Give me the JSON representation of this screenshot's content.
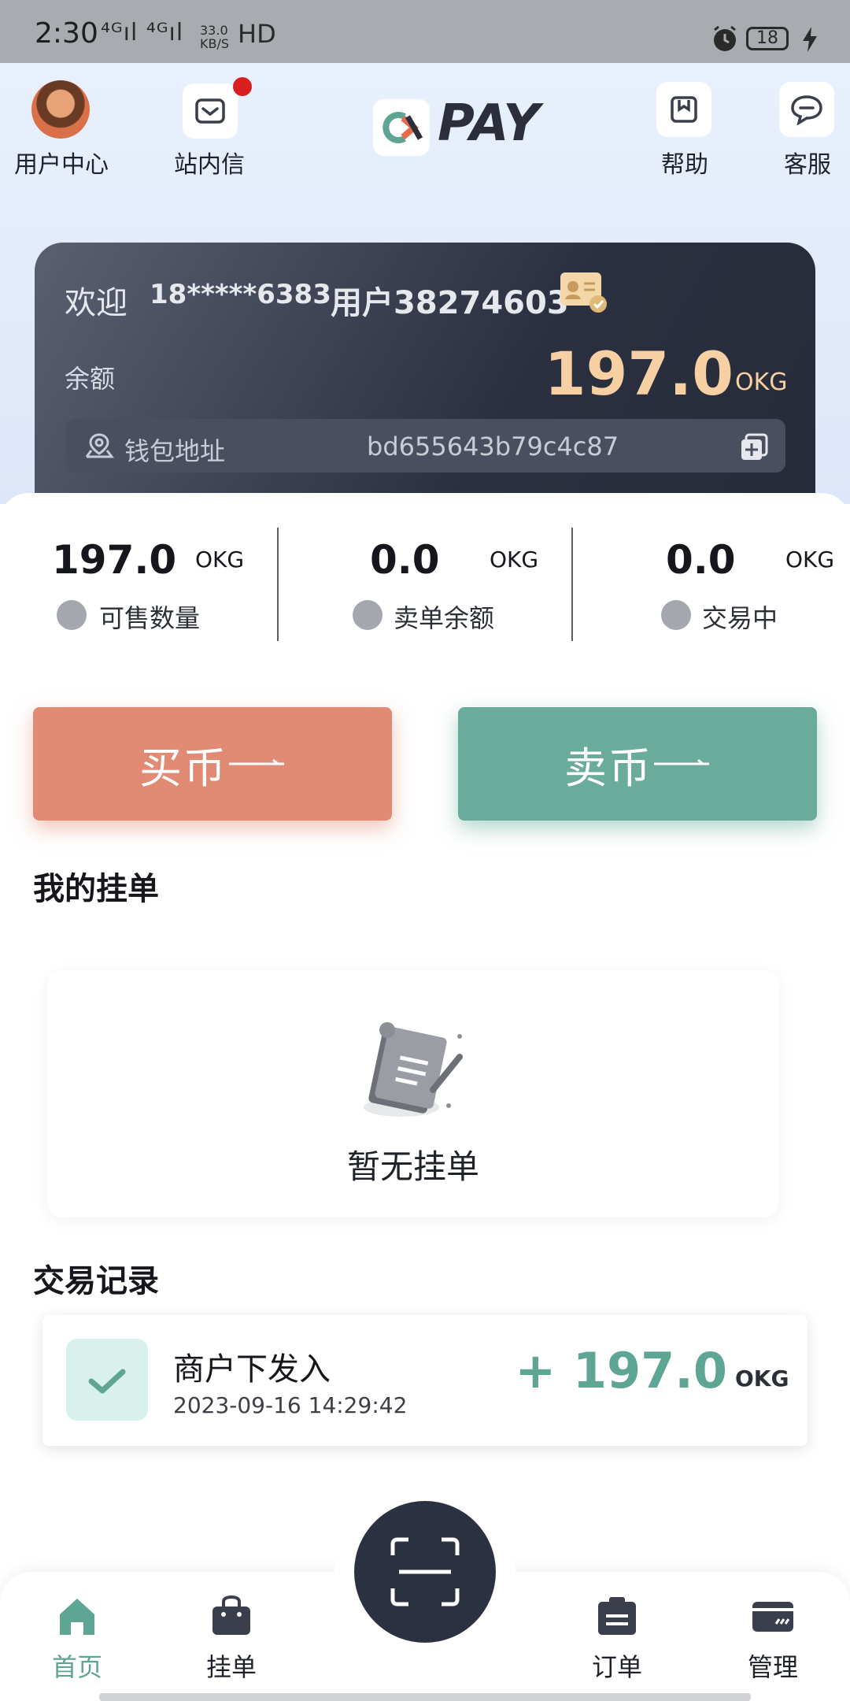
{
  "status_bar": {
    "time": "2:30",
    "network": "⁴ᴳıl ⁴ᴳıl",
    "speed_top": "33.0",
    "speed_bottom": "KB/S",
    "hd": "HD",
    "battery": "18"
  },
  "header": {
    "user_center": "用户中心",
    "inbox": "站内信",
    "logo_mark": "ok",
    "logo_text": "PAY",
    "help": "帮助",
    "service": "客服"
  },
  "account": {
    "welcome": "欢迎",
    "phone": "18*****6383",
    "user_name": "用户38274603",
    "balance_label": "余额",
    "balance_value": "197.0",
    "balance_unit": "OKG",
    "wallet_label": "钱包地址",
    "wallet_address": "bd655643b79c4c87"
  },
  "stats": [
    {
      "value": "197.0",
      "unit": "OKG",
      "label": "可售数量"
    },
    {
      "value": "0.0",
      "unit": "OKG",
      "label": "卖单余额"
    },
    {
      "value": "0.0",
      "unit": "OKG",
      "label": "交易中"
    }
  ],
  "actions": {
    "buy": "买币",
    "sell": "卖币"
  },
  "my_orders": {
    "title": "我的挂单",
    "empty_text": "暂无挂单"
  },
  "records": {
    "title": "交易记录",
    "items": [
      {
        "title": "商户下发入",
        "time": "2023-09-16 14:29:42",
        "amount": "+ 197.0",
        "unit": "OKG"
      }
    ]
  },
  "nav": {
    "home": "首页",
    "orders_listing": "挂单",
    "orders": "订单",
    "manage": "管理"
  },
  "colors": {
    "buy": "#e28b74",
    "sell": "#6aab9b",
    "balance": "#f6cfa2",
    "card": "#2b3040",
    "active_nav": "#5fa594"
  }
}
